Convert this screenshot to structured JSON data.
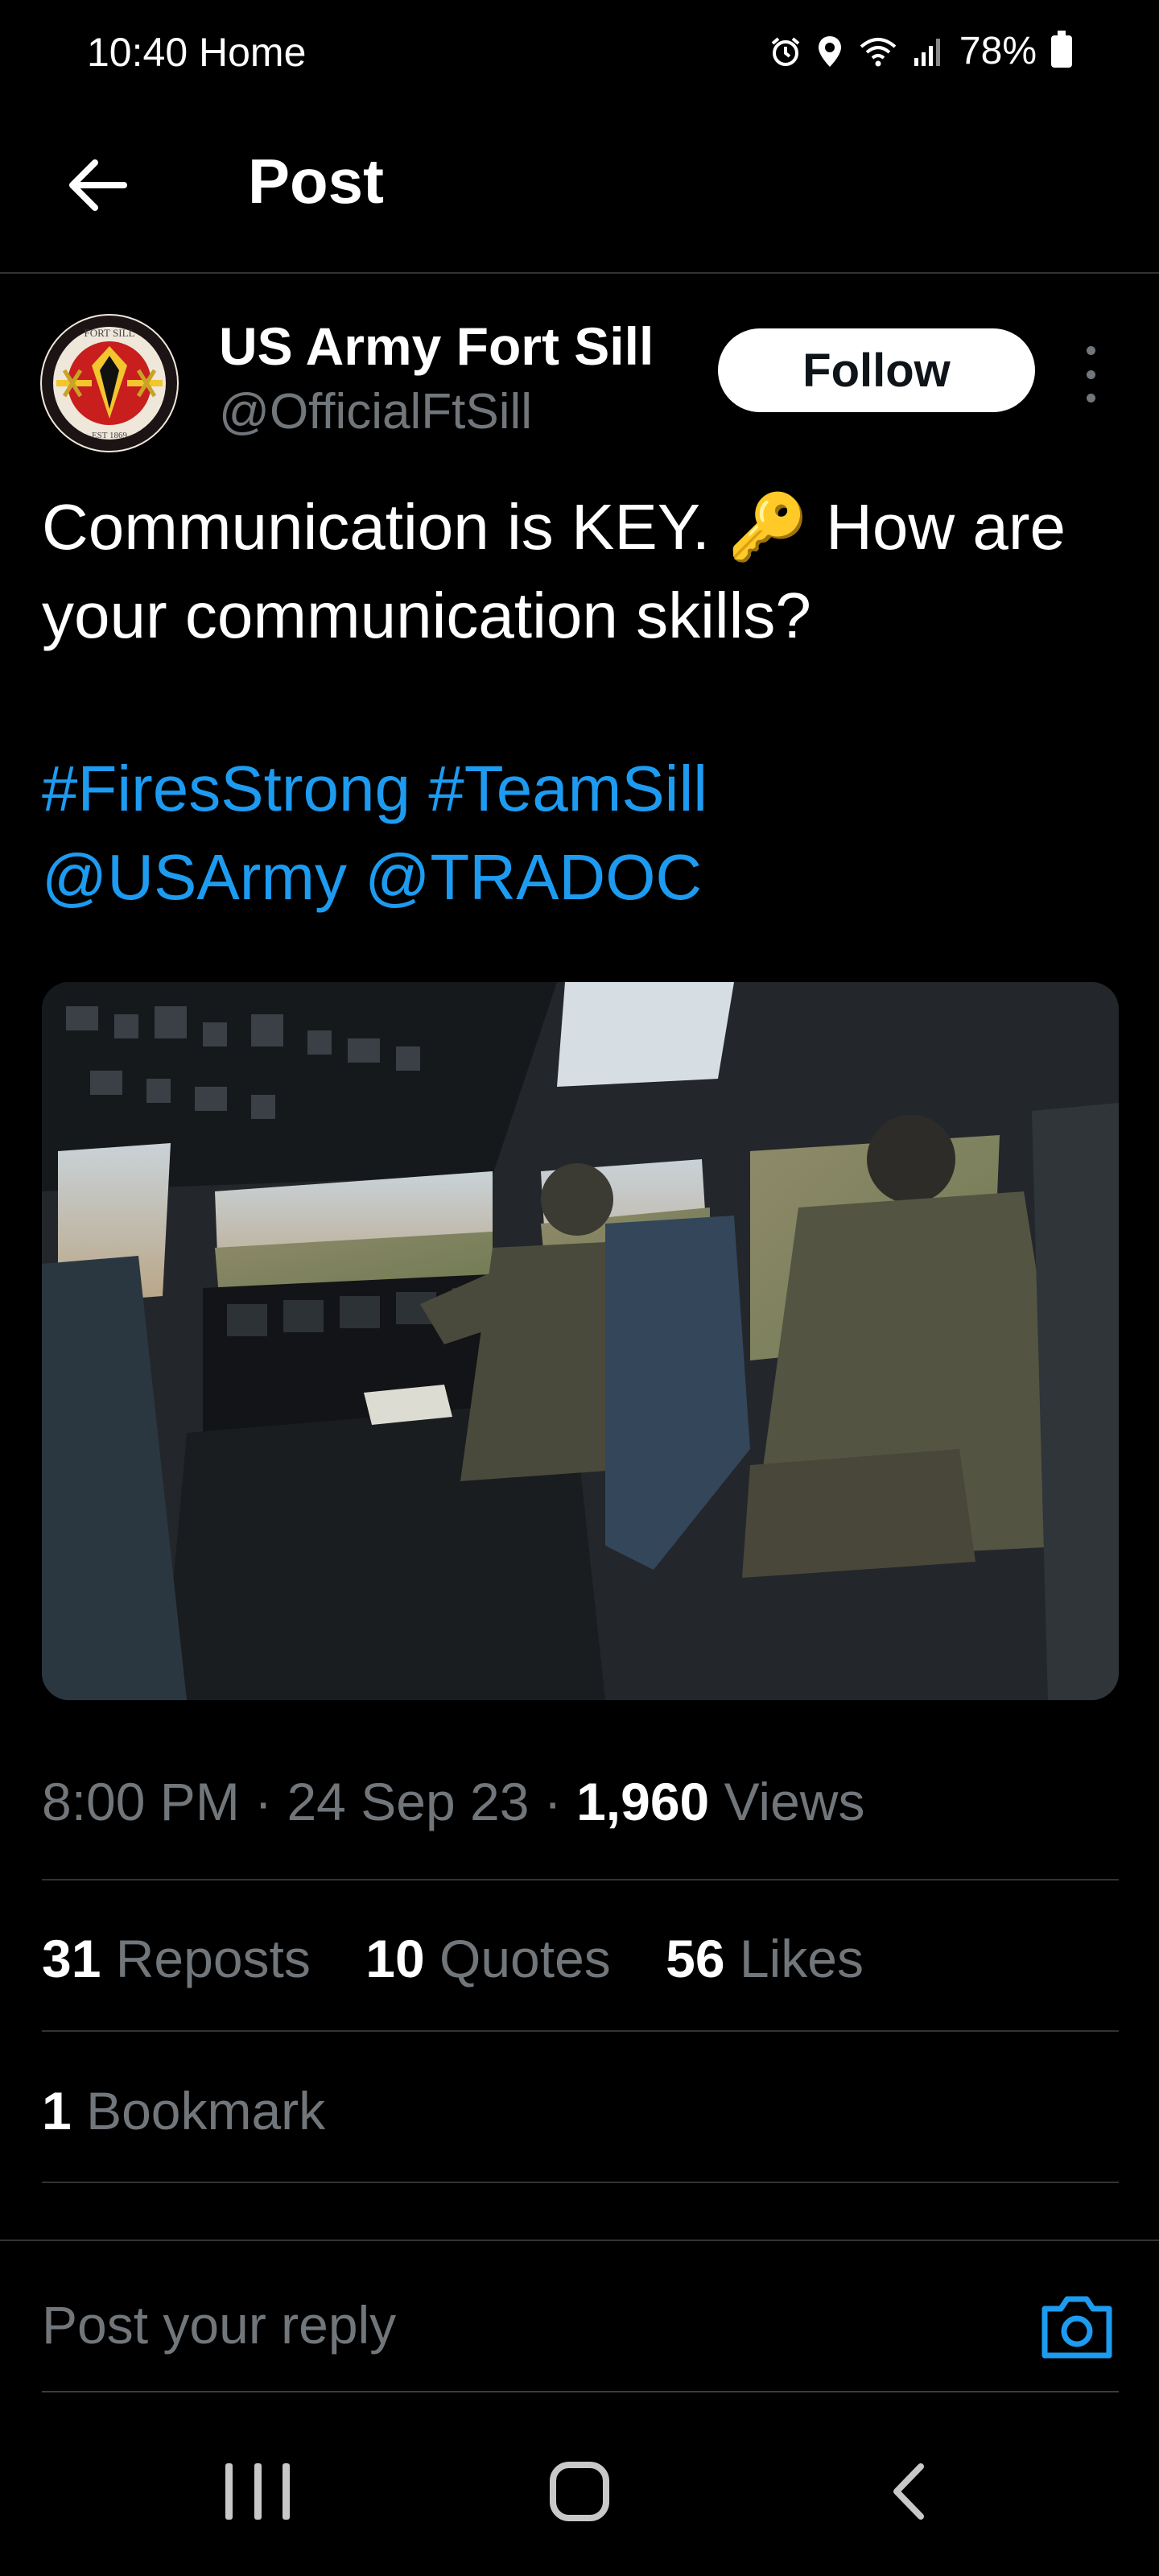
{
  "status_bar": {
    "time_label": "10:40 Home",
    "battery_label": "78%",
    "icons": [
      "alarm-icon",
      "location-icon",
      "wifi-icon",
      "signal-icon",
      "battery-icon"
    ]
  },
  "header": {
    "title": "Post",
    "back_icon": "back-arrow-icon"
  },
  "post": {
    "author": {
      "name": "US Army Fort Sill",
      "handle": "@OfficialFtSill",
      "avatar_caption_top": "FORT SILL",
      "avatar_caption_bottom": "EST 1869"
    },
    "follow_label": "Follow",
    "text_line1": "Communication is KEY. 🔑 How are your communication skills?",
    "hashtags": [
      "#FiresStrong",
      "#TeamSill"
    ],
    "mentions": [
      "@USArmy",
      "@TRADOC"
    ],
    "image_icon": "cockpit-photo",
    "meta": {
      "time": "8:00 PM",
      "date": "24 Sep 23",
      "views_count": "1,960",
      "views_label": "Views",
      "separator": "·"
    },
    "stats": {
      "reposts_count": "31",
      "reposts_label": "Reposts",
      "quotes_count": "10",
      "quotes_label": "Quotes",
      "likes_count": "56",
      "likes_label": "Likes",
      "bookmarks_count": "1",
      "bookmarks_label": "Bookmark"
    }
  },
  "reply": {
    "placeholder": "Post your reply",
    "camera_icon": "camera-icon"
  },
  "colors": {
    "background": "#000000",
    "link": "#1d9bf0",
    "muted": "#71767b",
    "divider": "#2f3336"
  }
}
